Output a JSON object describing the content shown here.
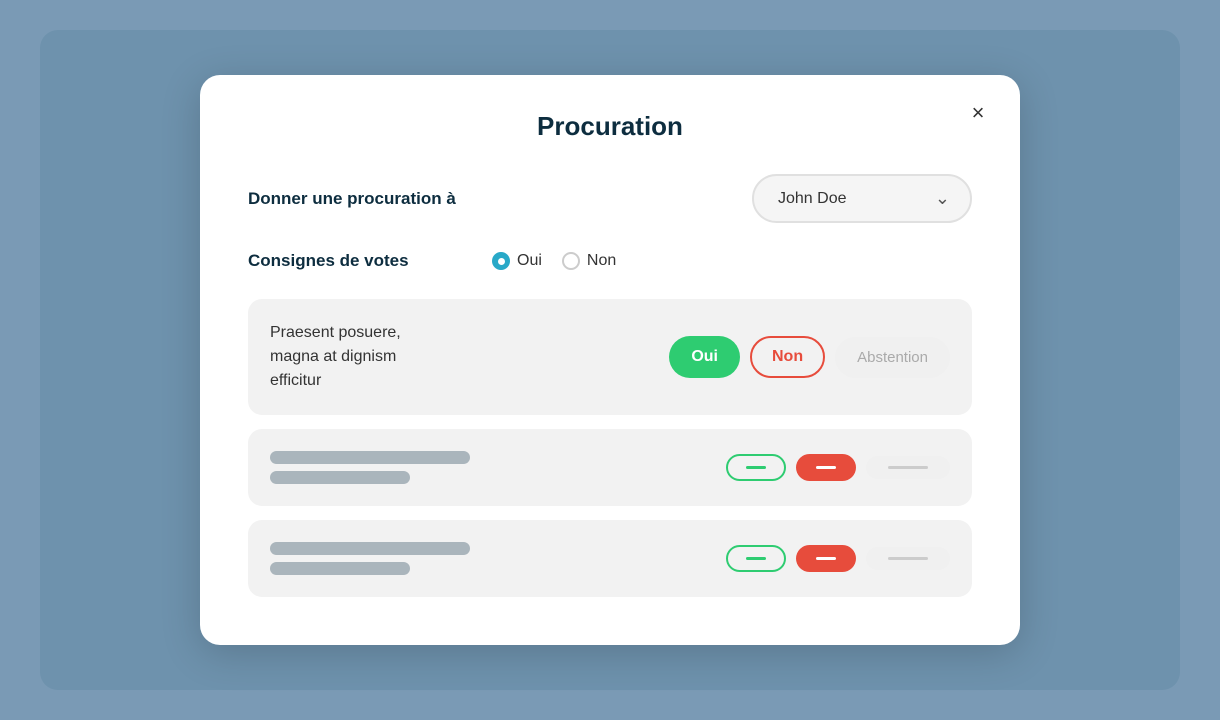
{
  "modal": {
    "title": "Procuration",
    "close_label": "×"
  },
  "procuration_row": {
    "label": "Donner une procuration à",
    "select_value": "John Doe",
    "chevron": "∨"
  },
  "consignes_row": {
    "label": "Consignes de votes",
    "radio_oui": "Oui",
    "radio_non": "Non"
  },
  "vote_card_1": {
    "text_line1": "Praesent posuere,",
    "text_line2": "magna at dignism",
    "text_line3": "efficitur",
    "btn_oui": "Oui",
    "btn_non": "Non",
    "btn_abstention": "Abstention"
  },
  "vote_card_2": {},
  "vote_card_3": {}
}
